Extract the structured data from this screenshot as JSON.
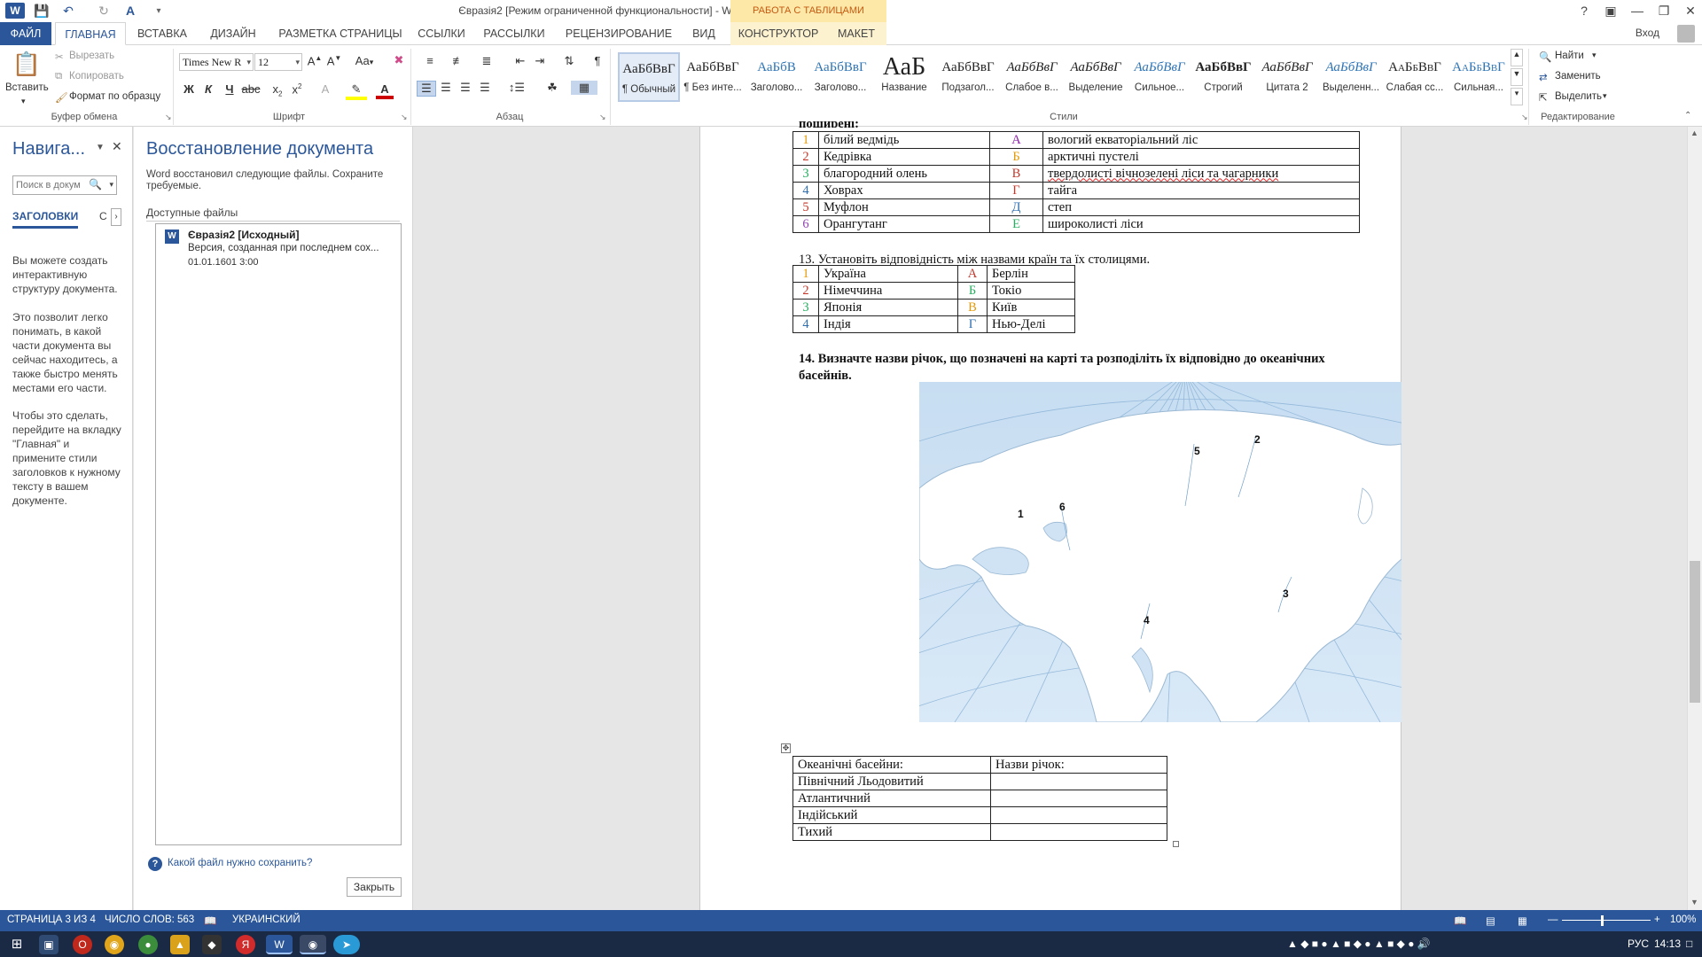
{
  "window": {
    "title": "Євразія2 [Режим ограниченной функциональности] - Word",
    "context_tab_group": "РАБОТА С ТАБЛИЦАМИ",
    "sign_in": "Вход"
  },
  "ribbon_tabs": [
    "ФАЙЛ",
    "ГЛАВНАЯ",
    "ВСТАВКА",
    "ДИЗАЙН",
    "РАЗМЕТКА СТРАНИЦЫ",
    "ССЫЛКИ",
    "РАССЫЛКИ",
    "РЕЦЕНЗИРОВАНИЕ",
    "ВИД",
    "КОНСТРУКТОР",
    "МАКЕТ"
  ],
  "clipboard": {
    "paste": "Вставить",
    "cut": "Вырезать",
    "copy": "Копировать",
    "format_painter": "Формат по образцу",
    "label": "Буфер обмена"
  },
  "font": {
    "name": "Times New R",
    "size": "12",
    "label": "Шрифт",
    "bold": "Ж",
    "italic": "К",
    "underline": "Ч",
    "case": "Аа"
  },
  "paragraph": {
    "label": "Абзац"
  },
  "styles": {
    "label": "Стили",
    "items": [
      {
        "sample": "АаБбВвГ",
        "label": "¶ Обычный"
      },
      {
        "sample": "АаБбВвГ",
        "label": "¶ Без инте..."
      },
      {
        "sample": "АаБбВ",
        "label": "Заголово..."
      },
      {
        "sample": "АаБбВвГ",
        "label": "Заголово..."
      },
      {
        "sample": "АаБ",
        "label": "Название"
      },
      {
        "sample": "АаБбВвГ",
        "label": "Подзагол..."
      },
      {
        "sample": "АаБбВвГ",
        "label": "Слабое в..."
      },
      {
        "sample": "АаБбВвГ",
        "label": "Выделение"
      },
      {
        "sample": "АаБбВвГ",
        "label": "Сильное..."
      },
      {
        "sample": "АаБбВвГ",
        "label": "Строгий"
      },
      {
        "sample": "АаБбВвГ",
        "label": "Цитата 2"
      },
      {
        "sample": "АаБбВвГ",
        "label": "Выделенн..."
      },
      {
        "sample": "АаБбВвГ",
        "label": "Слабая сс..."
      },
      {
        "sample": "АаБбВвГ",
        "label": "Сильная..."
      }
    ]
  },
  "editing": {
    "label": "Редактирование",
    "find": "Найти",
    "replace": "Заменить",
    "select": "Выделить"
  },
  "nav_pane": {
    "title": "Навига...",
    "search_placeholder": "Поиск в докум",
    "tab_headings": "ЗАГОЛОВКИ",
    "tab_pages": "С",
    "text1": "Вы можете создать интерактивную структуру документа.",
    "text2": "Это позволит легко понимать, в какой части документа вы сейчас находитесь, а также быстро менять местами его части.",
    "text3": "Чтобы это сделать, перейдите на вкладку \"Главная\" и примените стили заголовков к нужному тексту в вашем документе."
  },
  "recovery_pane": {
    "title": "Восстановление документа",
    "description": "Word восстановил следующие файлы.  Сохраните требуемые.",
    "available_label": "Доступные файлы",
    "file_name": "Євразія2  [Исходный]",
    "file_desc": "Версия, созданная при последнем сох...",
    "file_date": "01.01.1601 3:00",
    "help_link": "Какой файл нужно сохранить?",
    "close_button": "Закрыть"
  },
  "document": {
    "cut_line": "поширені:",
    "table1": [
      {
        "n": "1",
        "animal": "білий ведмідь",
        "l": "А",
        "habitat": "вологий екваторіальний ліс"
      },
      {
        "n": "2",
        "animal": "Кедрівка",
        "l": "Б",
        "habitat": "арктичні пустелі"
      },
      {
        "n": "3",
        "animal": "благородний олень",
        "l": "В",
        "habitat": "твердолисті вічнозелені ліси та чагарники"
      },
      {
        "n": "4",
        "animal": "Ховрах",
        "l": "Г",
        "habitat": "тайга"
      },
      {
        "n": "5",
        "animal": "Муфлон",
        "l": "Д",
        "habitat": "степ"
      },
      {
        "n": "6",
        "animal": "Орангутанг",
        "l": "Е",
        "habitat": "широколисті ліси"
      }
    ],
    "q13": "13. Установіть відповідність між назвами країн та їх столицями.",
    "table2": [
      {
        "n": "1",
        "country": "Україна",
        "l": "А",
        "capital": "Берлін"
      },
      {
        "n": "2",
        "country": "Німеччина",
        "l": "Б",
        "capital": "Токіо"
      },
      {
        "n": "3",
        "country": "Японія",
        "l": "В",
        "capital": "Київ"
      },
      {
        "n": "4",
        "country": "Індія",
        "l": "Г",
        "capital": "Нью-Делі"
      }
    ],
    "q14_line1": "14. Визначте назви річок, що позначені на карті та розподіліть їх відповідно до океанічних",
    "q14_line2": "басейнів.",
    "map_labels": [
      "1",
      "2",
      "3",
      "4",
      "5",
      "6"
    ],
    "table3_head": [
      "Океанічні басейни:",
      "Назви річок:"
    ],
    "table3_rows": [
      "Північний Льодовитий",
      "Атлантичний",
      "Індійський",
      "Тихий"
    ]
  },
  "colors": {
    "n_colors": [
      "#e39a0a",
      "#c0392b",
      "#27ae60",
      "#2f6fb0",
      "#c0392b",
      "#8e44ad"
    ],
    "l_colors": [
      "#8e24aa",
      "#e39a0a",
      "#c0392b",
      "#c0392b",
      "#2f6fb0",
      "#27ae60"
    ],
    "t2_n_colors": [
      "#e39a0a",
      "#c0392b",
      "#27ae60",
      "#2f6fb0"
    ],
    "t2_l_colors": [
      "#c0392b",
      "#27ae60",
      "#e39a0a",
      "#2f6fb0"
    ]
  },
  "status_bar": {
    "page": "СТРАНИЦА 3 ИЗ 4",
    "words": "ЧИСЛО СЛОВ: 563",
    "language": "УКРАИНСКИЙ",
    "zoom": "100%"
  },
  "taskbar": {
    "lang": "РУС",
    "time": "14:13"
  }
}
